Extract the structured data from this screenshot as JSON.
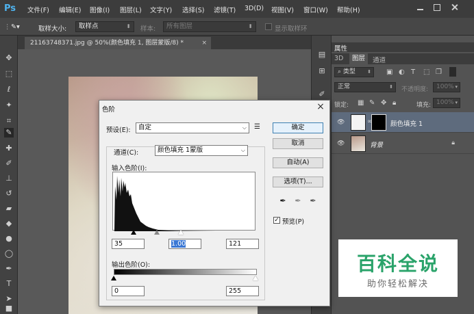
{
  "app": {
    "logo": "Ps",
    "menu": [
      "文件(F)",
      "编辑(E)",
      "图像(I)",
      "图层(L)",
      "文字(Y)",
      "选择(S)",
      "滤镜(T)",
      "3D(D)",
      "视图(V)",
      "窗口(W)",
      "帮助(H)"
    ]
  },
  "options": {
    "sample_size_label": "取样大小:",
    "sample_size_value": "取样点",
    "sample_label": "样本:",
    "sample_value": "所有图层",
    "show_ring_label": "显示取样环"
  },
  "document": {
    "tab_title": "21163748371.jpg @ 50%(颜色填充 1, 图层蒙版/8) *",
    "close": "×"
  },
  "right_panel": {
    "properties_tab": "属性",
    "tabs": [
      "3D",
      "图层",
      "通道"
    ],
    "filter_kind": "类型",
    "blend_mode": "正常",
    "opacity_label": "不透明度:",
    "opacity_value": "100%",
    "lock_label": "锁定:",
    "fill_label": "填充:",
    "fill_value": "100%",
    "layers": [
      {
        "name": "颜色填充 1",
        "selected": true
      },
      {
        "name": "背景",
        "selected": false
      }
    ]
  },
  "dialog": {
    "title": "色阶",
    "close": "×",
    "preset_label": "预设(E):",
    "preset_value": "自定",
    "channel_label": "通道(C):",
    "channel_value": "颜色填充 1蒙版",
    "input_levels_label": "输入色阶(I):",
    "output_levels_label": "输出色阶(O):",
    "input_black": "35",
    "input_gamma": "1.00",
    "input_white": "121",
    "output_black": "0",
    "output_white": "255",
    "buttons": {
      "ok": "确定",
      "cancel": "取消",
      "auto": "自动(A)",
      "options": "选项(T)..."
    },
    "preview_label": "预览(P)",
    "preview_checked": true
  },
  "watermark": {
    "title": "百科全说",
    "subtitle": "助你轻松解决"
  },
  "colors": {
    "accent": "#4fb3ef",
    "selected_layer": "#5e6b7d",
    "watermark_green": "#2aa36a"
  }
}
